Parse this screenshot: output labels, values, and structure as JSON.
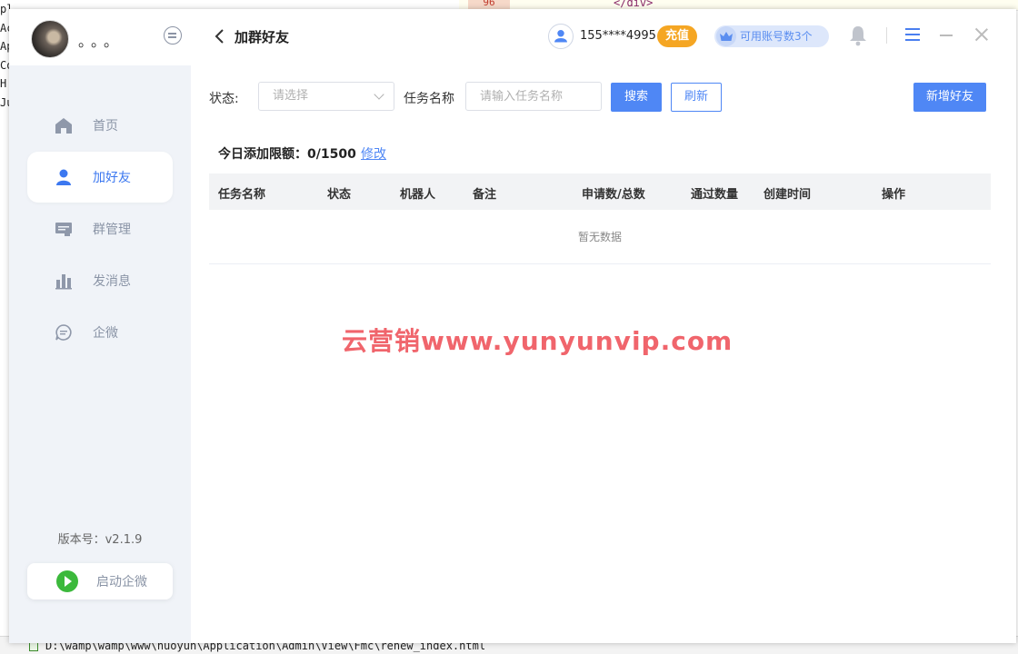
{
  "background": {
    "left_text": [
      "plication",
      "Ac",
      "Ap",
      "Co",
      "H",
      "Ju"
    ],
    "top_line_number": "96",
    "top_code": "</div>",
    "status_path": "D:\\wamp\\wamp\\www\\huoyun\\Application\\Admin\\View\\Fmc\\renew_index.html"
  },
  "sidebar": {
    "username": "。。。",
    "items": [
      {
        "label": "首页",
        "icon": "home-icon"
      },
      {
        "label": "加好友",
        "icon": "user-icon"
      },
      {
        "label": "群管理",
        "icon": "group-manage-icon"
      },
      {
        "label": "发消息",
        "icon": "chart-bars-icon"
      },
      {
        "label": "企微",
        "icon": "chat-bubble-icon"
      }
    ],
    "active_index": 1,
    "version": "版本号：v2.1.9",
    "start_button": "启动企微"
  },
  "header": {
    "title": "加群好友",
    "phone": "155****4995",
    "recharge": "充值",
    "accounts": "可用账号数3个"
  },
  "filters": {
    "status_label": "状态:",
    "status_placeholder": "请选择",
    "task_label": "任务名称",
    "task_placeholder": "请输入任务名称",
    "search_button": "搜索",
    "refresh_button": "刷新",
    "add_button": "新增好友"
  },
  "limit": {
    "text": "今日添加限额：0/1500",
    "edit_link": "修改"
  },
  "table": {
    "columns": [
      "任务名称",
      "状态",
      "机器人",
      "备注",
      "申请数/总数",
      "通过数量",
      "创建时间",
      "操作"
    ],
    "empty_text": "暂无数据"
  },
  "watermark": "云营销www.yunyunvip.com",
  "colors": {
    "primary": "#4f87f5",
    "recharge": "#f5a623",
    "watermark": "#f0656c",
    "sidebar_bg": "#f0f3f8"
  }
}
